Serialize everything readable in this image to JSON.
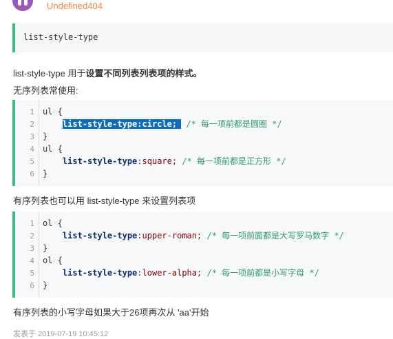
{
  "author": {
    "name": "Undefined404"
  },
  "quote": {
    "text": "list-style-type"
  },
  "intro": {
    "term": "list-style-type",
    "text1": " 用于",
    "bold": "设置不同列表列表项的样式。"
  },
  "unordered_label": "无序列表常使用:",
  "code1": [
    {
      "n": "1",
      "selector": "ul",
      "brace": " {"
    },
    {
      "n": "2",
      "prop": "list-style-type",
      "value": "circle",
      "comment": "/* 每一项前都是圆圈 */",
      "highlight": true
    },
    {
      "n": "3",
      "brace": "}"
    },
    {
      "n": "4",
      "selector": "ul",
      "brace": " {"
    },
    {
      "n": "5",
      "prop": "list-style-type",
      "value": "square",
      "comment": "/* 每一项前都是正方形 */"
    },
    {
      "n": "6",
      "brace": "}"
    }
  ],
  "ordered_label": "有序列表也可以用 list-style-type 来设置列表项",
  "code2": [
    {
      "n": "1",
      "selector": "ol",
      "brace": " {"
    },
    {
      "n": "2",
      "prop": "list-style-type",
      "value": "upper-roman",
      "comment": "/* 每一项前面都是大写罗马数字 */"
    },
    {
      "n": "3",
      "brace": "}"
    },
    {
      "n": "4",
      "selector": "ol",
      "brace": " {"
    },
    {
      "n": "5",
      "prop": "list-style-type",
      "value": "lower-alpha",
      "comment": "/* 每一项前都是小写字母 */"
    },
    {
      "n": "6",
      "brace": "}"
    }
  ],
  "note": "有序列表的小写字母如果大于26项再次从 'aa'开始",
  "footer": {
    "label": "发表于",
    "date": "2019-07-19 10:45:12"
  },
  "colors": {
    "accent": "#42b983",
    "username": "#f0883e",
    "selection": "#0a6cc5",
    "comment": "#2e9c6a",
    "keyword": "#0b2e6b"
  }
}
